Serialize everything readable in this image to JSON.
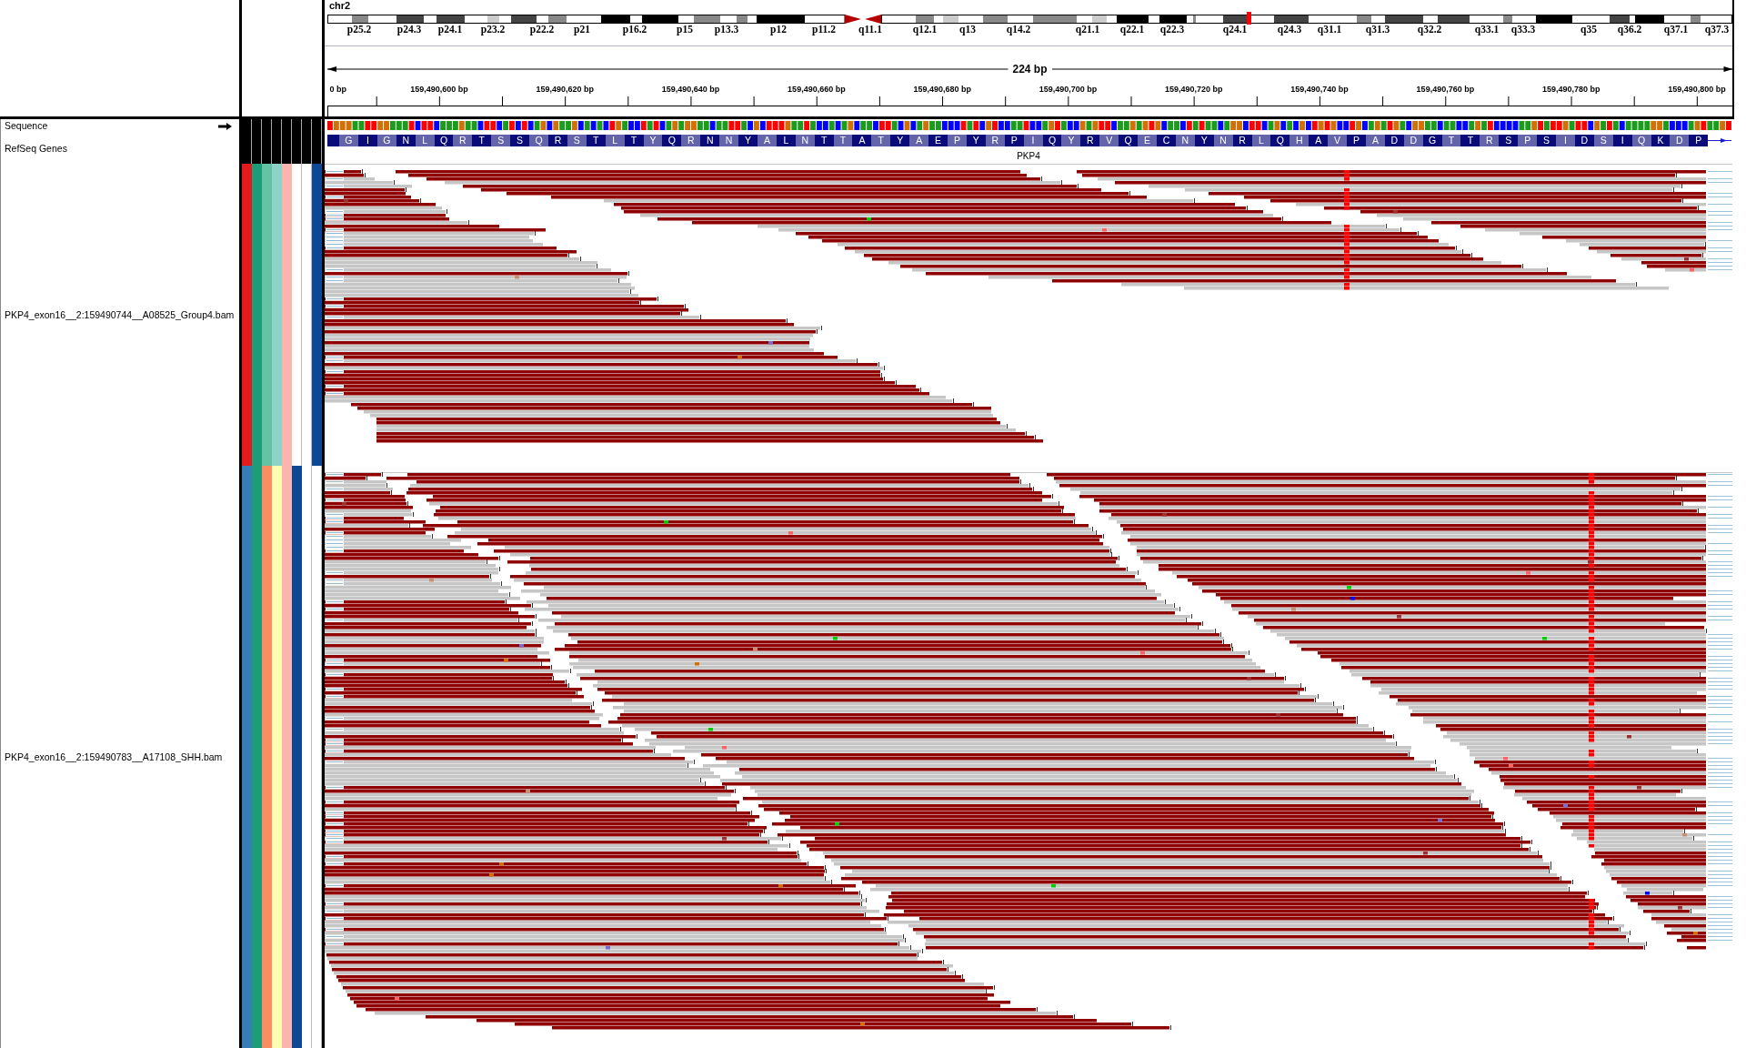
{
  "header": {
    "chromosome": "chr2",
    "cytobands": [
      "p25.2",
      "p24.3",
      "p24.1",
      "p23.2",
      "p22.2",
      "p21",
      "p16.2",
      "p15",
      "p13.3",
      "p12",
      "p11.2",
      "q11.1",
      "q12.1",
      "q13",
      "q14.2",
      "q21.1",
      "q22.1",
      "q22.3",
      "q24.1",
      "q24.3",
      "q31.1",
      "q31.3",
      "q32.2",
      "q33.1",
      "q33.3",
      "q35",
      "q36.2",
      "q37.1",
      "q37.3"
    ],
    "span": "224 bp",
    "ruler_labels": [
      "0 bp",
      "159,490,600 bp",
      "159,490,620 bp",
      "159,490,640 bp",
      "159,490,660 bp",
      "159,490,680 bp",
      "159,490,700 bp",
      "159,490,720 bp",
      "159,490,740 bp",
      "159,490,760 bp",
      "159,490,780 bp",
      "159,490,800 bp"
    ]
  },
  "feature_tracks": [
    {
      "kind": "sequence",
      "name": "Sequence",
      "strand_forward": true
    },
    {
      "kind": "gene",
      "name": "RefSeq Genes",
      "gene": {
        "name": "PKP4",
        "amino_acids": [
          "G",
          "I",
          "G",
          "N",
          "L",
          "Q",
          "R",
          "T",
          "S",
          "S",
          "Q",
          "R",
          "S",
          "T",
          "L",
          "T",
          "Y",
          "Q",
          "R",
          "N",
          "N",
          "Y",
          "A",
          "L",
          "N",
          "T",
          "T",
          "A",
          "T",
          "Y",
          "A",
          "E",
          "P",
          "Y",
          "R",
          "P",
          "I",
          "Q",
          "Y",
          "R",
          "V",
          "Q",
          "E",
          "C",
          "N",
          "Y",
          "N",
          "R",
          "L",
          "Q",
          "H",
          "A",
          "V",
          "P",
          "A",
          "D",
          "D",
          "G",
          "T",
          "T",
          "R",
          "S",
          "P",
          "S",
          "I",
          "D",
          "S",
          "I",
          "Q",
          "K",
          "D",
          "P"
        ]
      }
    }
  ],
  "alignment_tracks": [
    {
      "name": "PKP4_exon16__2:159490744__A08525_Group4.bam",
      "attributes": [
        {
          "kind": "swatch",
          "color": "#e41a1c"
        },
        {
          "kind": "swatch",
          "color": "#1b9e77"
        },
        {
          "kind": "swatch",
          "color": "#66c2a5"
        },
        {
          "kind": "swatch",
          "color": "#8dd3c7"
        },
        {
          "kind": "swatch",
          "color": "#fbb4ae"
        },
        {
          "kind": "blank"
        },
        {
          "kind": "blank"
        },
        {
          "kind": "swatch",
          "color": "#0c4896"
        }
      ]
    },
    {
      "name": "PKP4_exon16__2:159490783__A17108_SHH.bam",
      "attributes": [
        {
          "kind": "swatch",
          "color": "#377eb8"
        },
        {
          "kind": "swatch",
          "color": "#1b9e77"
        },
        {
          "kind": "swatch",
          "color": "#fc8d62"
        },
        {
          "kind": "swatch",
          "color": "#ffffb3"
        },
        {
          "kind": "swatch",
          "color": "#fbb4ae"
        },
        {
          "kind": "swatch",
          "color": "#0c4896"
        },
        {
          "kind": "blank"
        },
        {
          "kind": "blank"
        }
      ]
    }
  ]
}
